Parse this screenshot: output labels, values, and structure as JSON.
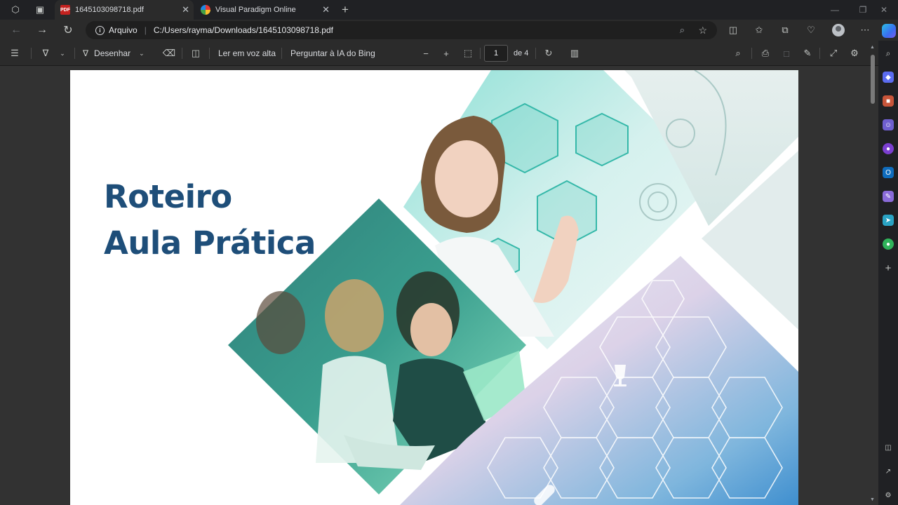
{
  "tabs": [
    {
      "title": "1645103098718.pdf",
      "favicon": "pdf-icon",
      "active": true
    },
    {
      "title": "Visual Paradigm Online",
      "favicon": "visual-paradigm-icon",
      "active": false
    }
  ],
  "address": {
    "scheme_label": "Arquivo",
    "url": "C:/Users/rayma/Downloads/1645103098718.pdf"
  },
  "pdf_toolbar": {
    "draw_label": "Desenhar",
    "read_aloud_label": "Ler em voz alta",
    "ask_ai_label": "Perguntar à IA do Bing",
    "page_current": "1",
    "page_total_label": "de 4"
  },
  "document": {
    "title_line1": "Roteiro",
    "title_line2": "Aula Prática"
  },
  "colors": {
    "title": "#1e4e79",
    "teal": "#3bbfb0",
    "browser_bg": "#202124"
  }
}
